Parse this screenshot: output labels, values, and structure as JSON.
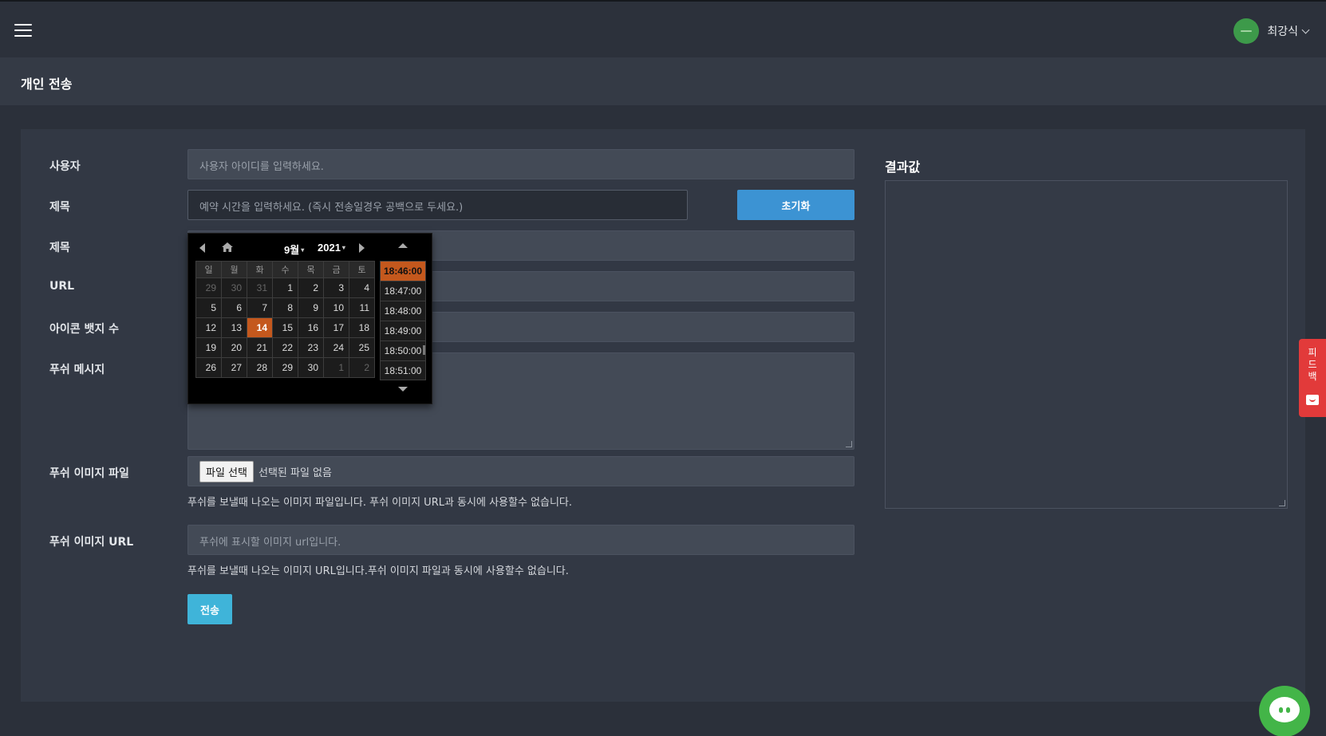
{
  "header": {
    "menu_icon": "hamburger-menu-icon",
    "user_name": "최강식"
  },
  "page": {
    "title": "개인 전송"
  },
  "form": {
    "user": {
      "label": "사용자",
      "placeholder": "사용자 아이디를 입력하세요."
    },
    "schedule": {
      "label": "제목",
      "placeholder": "예약 시간을  입력하세요. (즉시 전송일경우 공백으로 두세요.)",
      "reset_label": "초기화"
    },
    "title": {
      "label": "제목"
    },
    "url": {
      "label": "URL"
    },
    "badge": {
      "label": "아이콘 뱃지 수"
    },
    "message": {
      "label": "푸쉬 메시지"
    },
    "image_file": {
      "label": "푸쉬 이미지 파일",
      "button_label": "파일 선택",
      "status": "선택된 파일 없음",
      "help": "푸쉬를 보낼때 나오는 이미지 파일입니다. 푸쉬 이미지 URL과 동시에 사용할수 없습니다."
    },
    "image_url": {
      "label": "푸쉬 이미지 URL",
      "placeholder": "푸쉬에 표시할 이미지 url입니다.",
      "help": "푸쉬를 보낼때 나오는 이미지 URL입니다.푸쉬 이미지 파일과 동시에 사용할수 없습니다."
    },
    "send_label": "전송"
  },
  "result": {
    "title": "결과값"
  },
  "datepicker": {
    "month": "9월",
    "year": "2021",
    "weekdays": [
      "일",
      "월",
      "화",
      "수",
      "목",
      "금",
      "토"
    ],
    "weeks": [
      [
        {
          "d": "29",
          "o": true
        },
        {
          "d": "30",
          "o": true
        },
        {
          "d": "31",
          "o": true
        },
        {
          "d": "1"
        },
        {
          "d": "2"
        },
        {
          "d": "3"
        },
        {
          "d": "4"
        }
      ],
      [
        {
          "d": "5"
        },
        {
          "d": "6"
        },
        {
          "d": "7"
        },
        {
          "d": "8"
        },
        {
          "d": "9"
        },
        {
          "d": "10"
        },
        {
          "d": "11"
        }
      ],
      [
        {
          "d": "12"
        },
        {
          "d": "13"
        },
        {
          "d": "14",
          "c": true
        },
        {
          "d": "15"
        },
        {
          "d": "16"
        },
        {
          "d": "17"
        },
        {
          "d": "18"
        }
      ],
      [
        {
          "d": "19"
        },
        {
          "d": "20"
        },
        {
          "d": "21"
        },
        {
          "d": "22"
        },
        {
          "d": "23"
        },
        {
          "d": "24"
        },
        {
          "d": "25"
        }
      ],
      [
        {
          "d": "26"
        },
        {
          "d": "27"
        },
        {
          "d": "28"
        },
        {
          "d": "29"
        },
        {
          "d": "30"
        },
        {
          "d": "1",
          "o": true
        },
        {
          "d": "2",
          "o": true
        }
      ]
    ],
    "times": [
      "18:46:00",
      "18:47:00",
      "18:48:00",
      "18:49:00",
      "18:50:00",
      "18:51:00"
    ],
    "selected_time": "18:46:00",
    "accent_color": "#c4581d"
  },
  "feedback": {
    "chars": [
      "피",
      "드",
      "백"
    ]
  },
  "colors": {
    "background": "#2b303a",
    "card": "#323844",
    "primary_button": "#3c93d3",
    "send_button": "#3fb4d9",
    "feedback": "#e23a3a",
    "chat": "#43b548"
  }
}
